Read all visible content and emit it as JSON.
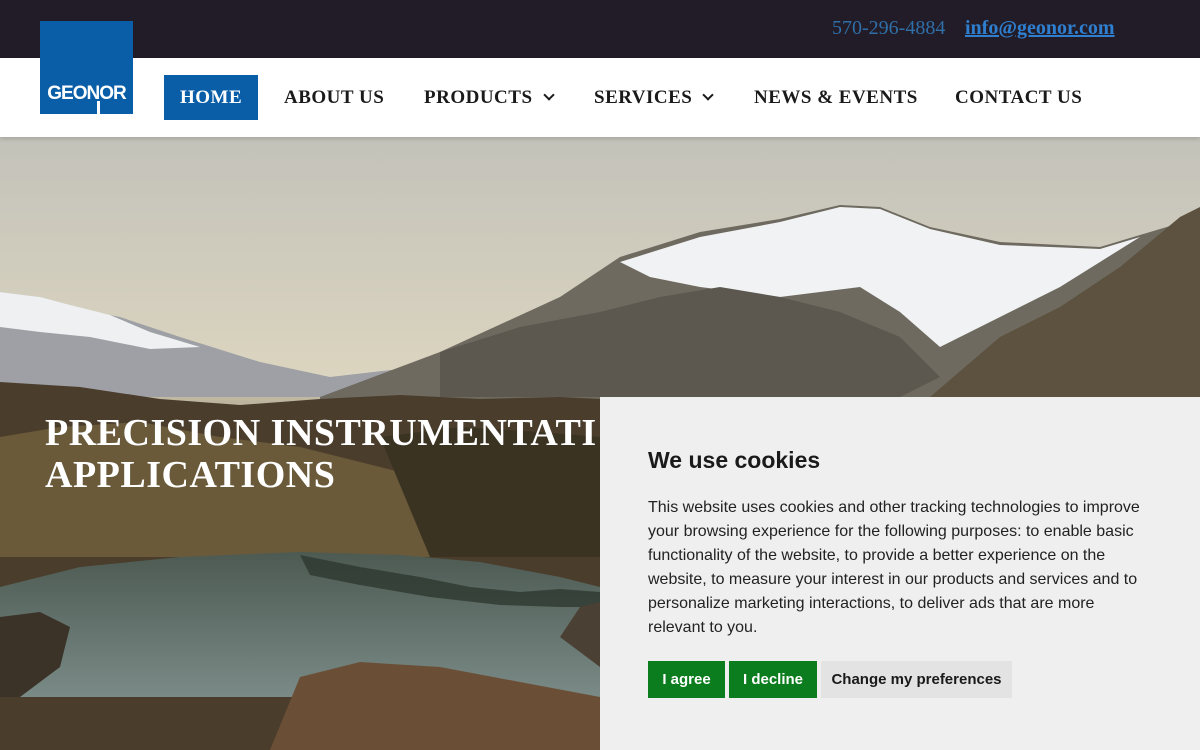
{
  "topbar": {
    "phone": "570-296-4884",
    "email": "info@geonor.com"
  },
  "logo": {
    "text": "GEONOR",
    "color": "#0a5ea8"
  },
  "nav": {
    "items": [
      {
        "label": "HOME",
        "active": true,
        "dropdown": false
      },
      {
        "label": "ABOUT US",
        "active": false,
        "dropdown": false
      },
      {
        "label": "PRODUCTS",
        "active": false,
        "dropdown": true
      },
      {
        "label": "SERVICES",
        "active": false,
        "dropdown": true
      },
      {
        "label": "NEWS & EVENTS",
        "active": false,
        "dropdown": false
      },
      {
        "label": "CONTACT US",
        "active": false,
        "dropdown": false
      }
    ]
  },
  "hero": {
    "title_line1": "PRECISION INSTRUMENTATI",
    "title_line2": "APPLICATIONS"
  },
  "cookie": {
    "title": "We use cookies",
    "body": "This website uses cookies and other tracking technologies to improve your browsing experience for the following purposes: to enable basic functionality of the website, to provide a better experience on the website, to measure your interest in our products and services and to personalize marketing interactions, to deliver ads that are more relevant to you.",
    "agree_label": "I agree",
    "decline_label": "I decline",
    "prefs_label": "Change my preferences",
    "accent": "#0b7d1e"
  }
}
